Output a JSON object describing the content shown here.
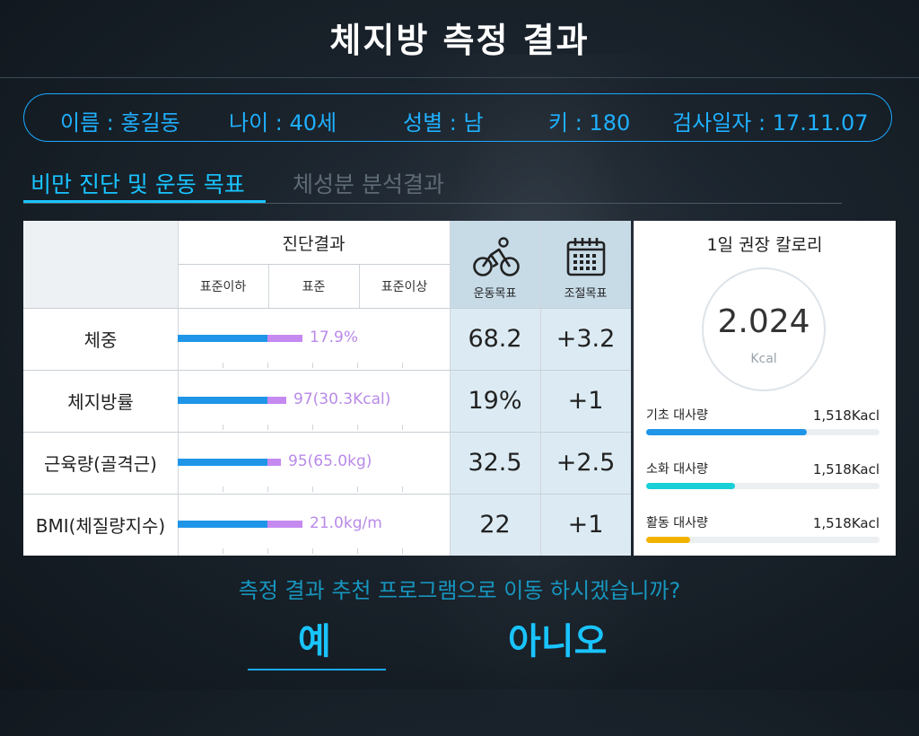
{
  "title": "체지방 측정 결과",
  "info": {
    "name": "이름 : 홍길동",
    "age": "나이 : 40세",
    "gender": "성별 : 남",
    "height": "키 : 180",
    "date": "검사일자 : 17.11.07"
  },
  "tabs": [
    {
      "label": "비만 진단 및 운동 목표",
      "active": true
    },
    {
      "label": "체성분 분석결과",
      "active": false
    }
  ],
  "table": {
    "diagnosis_header": "진단결과",
    "sub_headers": [
      "표준이하",
      "표준",
      "표준이상"
    ],
    "goal_header": "운동목표",
    "adjust_header": "조절목표",
    "goal_icon": "cyclist-icon",
    "adjust_icon": "calendar-icon",
    "rows": [
      {
        "label": "체중",
        "bar_label": "17.9%",
        "blue_fraction": 0.33,
        "purple_fraction": 0.13,
        "goal": "68.2",
        "adjust": "+3.2"
      },
      {
        "label": "체지방률",
        "bar_label": "97(30.3Kcal)",
        "blue_fraction": 0.33,
        "purple_fraction": 0.07,
        "goal": "19%",
        "adjust": "+1"
      },
      {
        "label": "근육량(골격근)",
        "bar_label": "95(65.0kg)",
        "blue_fraction": 0.33,
        "purple_fraction": 0.05,
        "goal": "32.5",
        "adjust": "+2.5"
      },
      {
        "label": "BMI(체질량지수)",
        "bar_label": "21.0kg/m",
        "blue_fraction": 0.33,
        "purple_fraction": 0.13,
        "goal": "22",
        "adjust": "+1"
      }
    ]
  },
  "calorie": {
    "title": "1일 권장 칼로리",
    "value": "2.024",
    "unit": "Kcal",
    "items": [
      {
        "label": "기초 대사량",
        "value": "1,518Kacl",
        "fraction": 0.69,
        "color": "#1f95e8"
      },
      {
        "label": "소화 대사량",
        "value": "1,518Kacl",
        "fraction": 0.38,
        "color": "#19cfd8"
      },
      {
        "label": "활동 대사량",
        "value": "1,518Kacl",
        "fraction": 0.19,
        "color": "#f2b200"
      }
    ]
  },
  "question": "측정 결과 추천 프로그램으로 이동 하시겠습니까?",
  "buttons": {
    "yes": "예",
    "no": "아니오"
  },
  "colors": {
    "accent": "#19c4ff",
    "info_border": "#19a9ff",
    "bar_blue": "#1f95e8",
    "bar_purple": "#c58af0"
  }
}
